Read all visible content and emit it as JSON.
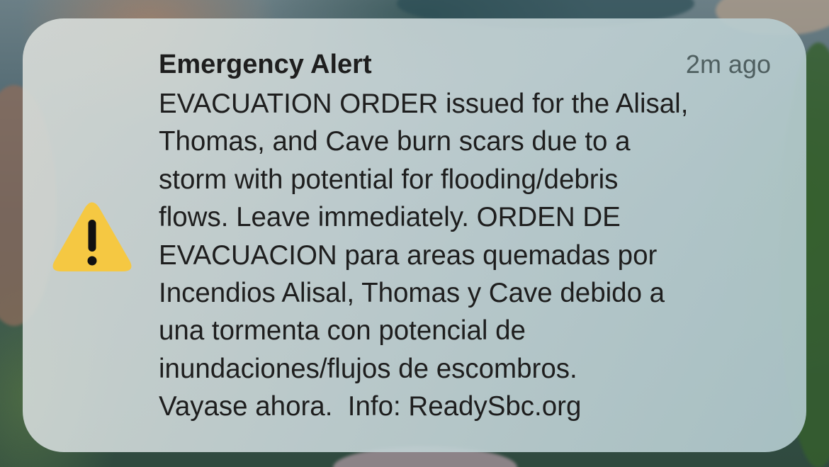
{
  "notification": {
    "title": "Emergency Alert",
    "timestamp": "2m ago",
    "icon": "warning-triangle-icon",
    "icon_color": "#f5c842",
    "body_lines": [
      "EVACUATION ORDER issued for the Alisal,",
      "Thomas, and Cave burn scars due to a",
      "storm with potential for flooding/debris",
      "flows. Leave immediately. ORDEN DE",
      "EVACUACION para areas quemadas por",
      "Incendios Alisal, Thomas y Cave debido a",
      "una tormenta con potencial de",
      "inundaciones/flujos de escombros.",
      "Vayase ahora.  Info: ReadySbc.org"
    ]
  }
}
